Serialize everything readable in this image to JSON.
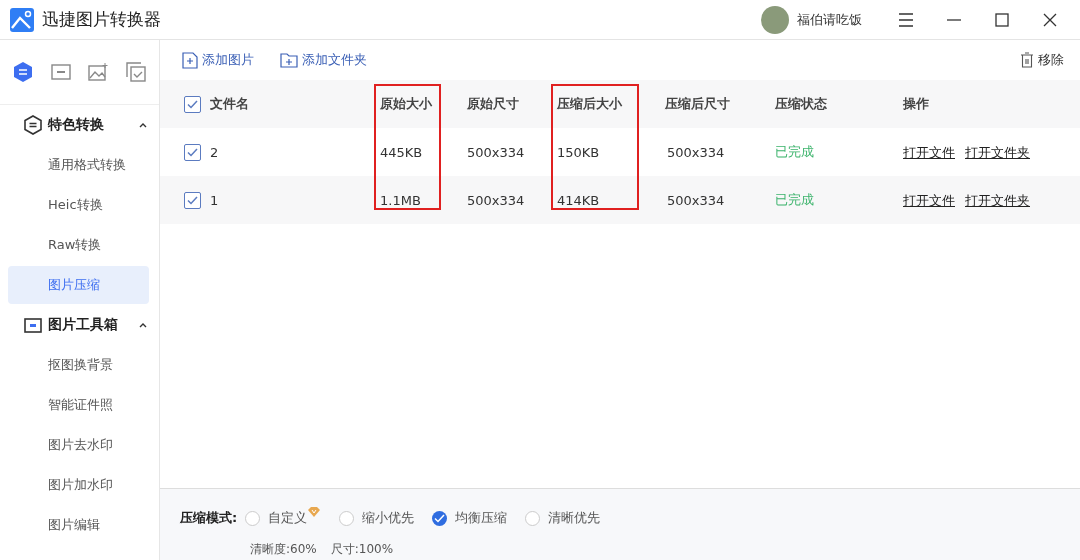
{
  "window": {
    "title": "迅捷图片转换器",
    "user": "福伯请吃饭"
  },
  "sidebar": {
    "tabs": [
      {
        "selected": true
      },
      {
        "selected": false
      },
      {
        "selected": false
      },
      {
        "selected": false
      }
    ],
    "groups": [
      {
        "label": "特色转换",
        "expanded": true,
        "items": [
          {
            "label": "通用格式转换",
            "selected": false
          },
          {
            "label": "Heic转换",
            "selected": false
          },
          {
            "label": "Raw转换",
            "selected": false
          },
          {
            "label": "图片压缩",
            "selected": true
          }
        ]
      },
      {
        "label": "图片工具箱",
        "expanded": true,
        "items": [
          {
            "label": "抠图换背景",
            "selected": false
          },
          {
            "label": "智能证件照",
            "selected": false
          },
          {
            "label": "图片去水印",
            "selected": false
          },
          {
            "label": "图片加水印",
            "selected": false
          },
          {
            "label": "图片编辑",
            "selected": false
          }
        ]
      }
    ]
  },
  "toolbar": {
    "add_image": "添加图片",
    "add_folder": "添加文件夹",
    "remove": "移除"
  },
  "table": {
    "all_checked": true,
    "columns": [
      {
        "label": "文件名",
        "highlighted": false
      },
      {
        "label": "原始大小",
        "highlighted": true
      },
      {
        "label": "原始尺寸",
        "highlighted": false
      },
      {
        "label": "压缩后大小",
        "highlighted": true
      },
      {
        "label": "压缩后尺寸",
        "highlighted": false
      },
      {
        "label": "压缩状态",
        "highlighted": false
      },
      {
        "label": "操作",
        "highlighted": false
      }
    ],
    "rows": [
      {
        "checked": true,
        "name": "2",
        "original_size": "445KB",
        "original_dim": "500x334",
        "compressed_size": "150KB",
        "compressed_dim": "500x334",
        "status": "已完成",
        "actions": [
          "打开文件",
          "打开文件夹"
        ]
      },
      {
        "checked": true,
        "name": "1",
        "original_size": "1.1MB",
        "original_dim": "500x334",
        "compressed_size": "414KB",
        "compressed_dim": "500x334",
        "status": "已完成",
        "actions": [
          "打开文件",
          "打开文件夹"
        ]
      }
    ]
  },
  "compress_mode": {
    "label": "压缩模式:",
    "options": [
      {
        "label": "自定义",
        "selected": false,
        "vip": true
      },
      {
        "label": "缩小优先",
        "selected": false,
        "vip": false
      },
      {
        "label": "均衡压缩",
        "selected": true,
        "vip": false
      },
      {
        "label": "清晰优先",
        "selected": false,
        "vip": false
      }
    ],
    "clarity": "清晰度:60%",
    "size": "尺寸:100%"
  }
}
